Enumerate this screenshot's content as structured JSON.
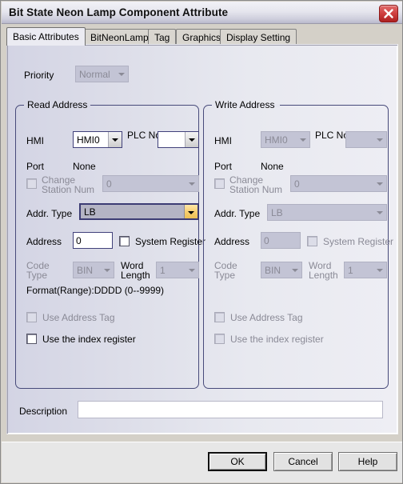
{
  "window": {
    "title": "Bit State Neon Lamp Component Attribute",
    "close_icon": "close-icon"
  },
  "tabs": [
    {
      "label": "Basic Attributes",
      "active": true
    },
    {
      "label": "BitNeonLamp",
      "active": false
    },
    {
      "label": "Tag",
      "active": false
    },
    {
      "label": "Graphics",
      "active": false
    },
    {
      "label": "Display Setting",
      "active": false
    }
  ],
  "priority": {
    "label": "Priority",
    "value": "Normal",
    "enabled": false
  },
  "read_address": {
    "group_title": "Read Address",
    "hmi_label": "HMI",
    "hmi_value": "HMI0",
    "plc_label": "PLC No.",
    "plc_value": "",
    "port_label": "Port",
    "port_value": "None",
    "change_station_label": "Change Station Num",
    "change_station_value": "0",
    "addr_type_label": "Addr. Type",
    "addr_type_value": "LB",
    "address_label": "Address",
    "address_value": "0",
    "system_register_label": "System Register",
    "code_type_label": "Code Type",
    "code_type_value": "BIN",
    "word_length_label": "Word Length",
    "word_length_value": "1",
    "format_text": "Format(Range):DDDD (0--9999)",
    "use_address_tag_label": "Use Address Tag",
    "use_index_register_label": "Use the index register"
  },
  "write_address": {
    "group_title": "Write Address",
    "hmi_label": "HMI",
    "hmi_value": "HMI0",
    "plc_label": "PLC No.",
    "plc_value": "",
    "port_label": "Port",
    "port_value": "None",
    "change_station_label": "Change Station Num",
    "change_station_value": "0",
    "addr_type_label": "Addr. Type",
    "addr_type_value": "LB",
    "address_label": "Address",
    "address_value": "0",
    "system_register_label": "System Register",
    "code_type_label": "Code Type",
    "code_type_value": "BIN",
    "word_length_label": "Word Length",
    "word_length_value": "1",
    "use_address_tag_label": "Use Address Tag",
    "use_index_register_label": "Use the index register"
  },
  "description": {
    "label": "Description",
    "value": ""
  },
  "buttons": {
    "ok": "OK",
    "cancel": "Cancel",
    "help": "Help"
  },
  "colors": {
    "group_border": "#474a7a",
    "combo_highlight": "#f7cf72",
    "close_button": "#cf4040",
    "disabled_text": "#8a8a96"
  }
}
